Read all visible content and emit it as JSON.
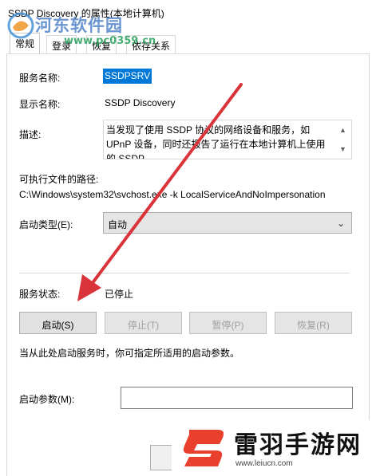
{
  "window": {
    "title": "SSDP Discovery 的属性(本地计算机)"
  },
  "tabs": [
    {
      "label": "常规"
    },
    {
      "label": "登录"
    },
    {
      "label": "恢复"
    },
    {
      "label": "依存关系"
    }
  ],
  "general": {
    "service_name_label": "服务名称:",
    "service_name_value": "SSDPSRV",
    "display_name_label": "显示名称:",
    "display_name_value": "SSDP Discovery",
    "description_label": "描述:",
    "description_value": "当发现了使用 SSDP 协议的网络设备和服务，如 UPnP 设备，同时还报告了运行在本地计算机上使用的 SSDP",
    "exe_path_label": "可执行文件的路径:",
    "exe_path_value": "C:\\Windows\\system32\\svchost.exe -k LocalServiceAndNoImpersonation",
    "startup_type_label": "启动类型(E):",
    "startup_type_value": "自动",
    "status_label": "服务状态:",
    "status_value": "已停止",
    "buttons": {
      "start": "启动(S)",
      "stop": "停止(T)",
      "pause": "暂停(P)",
      "resume": "恢复(R)"
    },
    "hint": "当从此处启动服务时，你可指定所适用的启动参数。",
    "start_params_label": "启动参数(M):",
    "start_params_value": ""
  },
  "watermarks": {
    "top_name": "河东软件园",
    "top_url": "www.pc0359.cn",
    "bottom_name": "雷羽手游网",
    "bottom_url": "www.leiucn.com"
  },
  "colors": {
    "selection": "#0078d7",
    "arrow": "#d9343a",
    "logo_red": "#e8402c"
  },
  "icons": {
    "dropdown": "chevron-down-icon",
    "scroll_up": "scroll-up-icon",
    "scroll_down": "scroll-down-icon"
  }
}
